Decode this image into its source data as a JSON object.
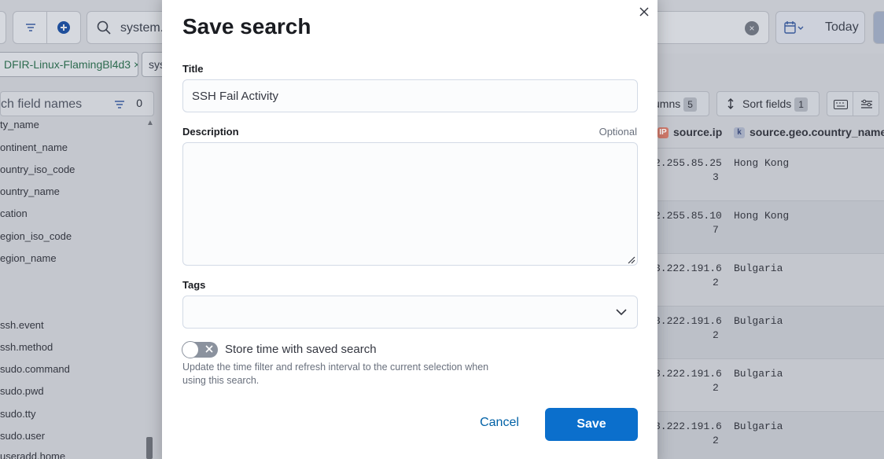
{
  "background": {
    "search": {
      "text": "system."
    },
    "date": {
      "label": "Today"
    },
    "filters": [
      {
        "label": "DFIR-Linux-FlamingBl4d3 ×"
      },
      {
        "label": "sys"
      }
    ],
    "sidebar": {
      "search_placeholder": "ch field names",
      "filter_count": "0",
      "fields": [
        "ty_name",
        "ontinent_name",
        "ountry_iso_code",
        "ountry_name",
        "cation",
        "egion_iso_code",
        "egion_name",
        "ssh.event",
        "ssh.method",
        "sudo.command",
        "sudo.pwd",
        "sudo.tty",
        "sudo.user",
        "useradd.home"
      ]
    },
    "toolbar": {
      "columns_label": "umns",
      "columns_count": "5",
      "sort_label": "Sort fields",
      "sort_count": "1"
    },
    "table": {
      "headers": [
        {
          "type": "IP",
          "label": "source.ip"
        },
        {
          "type": "k",
          "label": "source.geo.country_name"
        }
      ],
      "rows": [
        {
          "ip1": "2.255.85.25",
          "ip2": "3",
          "country": "Hong Kong"
        },
        {
          "ip1": "2.255.85.10",
          "ip2": "7",
          "country": "Hong Kong"
        },
        {
          "ip1": "3.222.191.6",
          "ip2": "2",
          "country": "Bulgaria"
        },
        {
          "ip1": "3.222.191.6",
          "ip2": "2",
          "country": "Bulgaria"
        },
        {
          "ip1": "3.222.191.6",
          "ip2": "2",
          "country": "Bulgaria"
        },
        {
          "ip1": "3.222.191.6",
          "ip2": "2",
          "country": "Bulgaria"
        }
      ]
    }
  },
  "modal": {
    "title": "Save search",
    "title_label": "Title",
    "title_value": "SSH Fail Activity",
    "description_label": "Description",
    "description_optional": "Optional",
    "description_value": "",
    "tags_label": "Tags",
    "store_time_label": "Store time with saved search",
    "store_time_help": "Update the time filter and refresh interval to the current selection when using this search.",
    "store_time_enabled": false,
    "cancel_label": "Cancel",
    "save_label": "Save"
  },
  "colors": {
    "primary": "#0b6fcc",
    "link": "#0061a6",
    "overlay": "#bcc0c8"
  }
}
